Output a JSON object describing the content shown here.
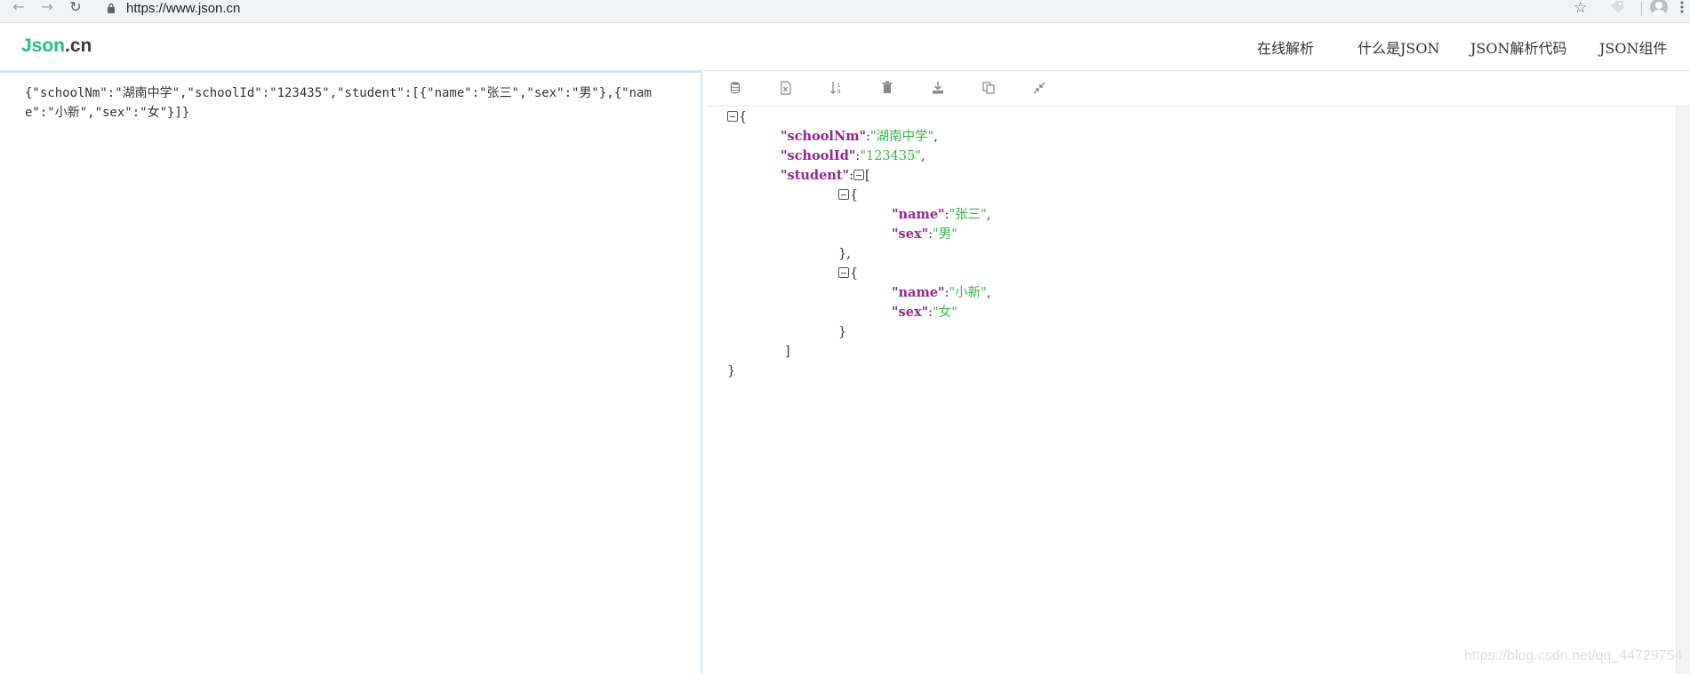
{
  "browser": {
    "url": "https://www.json.cn",
    "icons": [
      "back-icon",
      "forward-icon",
      "reload-icon",
      "lock-icon",
      "star-icon",
      "extension-icon",
      "profile-icon",
      "menu-icon"
    ]
  },
  "header": {
    "logo_brand": "Json",
    "logo_tld": ".cn",
    "nav": [
      "在线解析",
      "什么是JSON",
      "JSON解析代码",
      "JSON组件"
    ]
  },
  "editor": {
    "value": "{\"schoolNm\":\"湖南中学\",\"schoolId\":\"123435\",\"student\":[{\"name\":\"张三\",\"sex\":\"男\"},{\"name\":\"小新\",\"sex\":\"女\"}]}"
  },
  "toolbar": {
    "icons": [
      "database-icon",
      "excel-icon",
      "sort-icon",
      "trash-icon",
      "download-icon",
      "copy-icon",
      "compress-icon"
    ]
  },
  "tree": {
    "k_schoolNm": "\"schoolNm\"",
    "v_schoolNm": "\"湖南中学\"",
    "k_schoolId": "\"schoolId\"",
    "v_schoolId": "\"123435\"",
    "k_student": "\"student\"",
    "k_name": "\"name\"",
    "k_sex": "\"sex\"",
    "v_name_1": "\"张三\"",
    "v_sex_1": "\"男\"",
    "v_name_2": "\"小新\"",
    "v_sex_2": "\"女\""
  },
  "watermark": "https://blog.csdn.net/qq_44729754",
  "colors": {
    "brand_green": "#1ec27e",
    "json_key": "#92278f",
    "json_string": "#3ab54a"
  }
}
